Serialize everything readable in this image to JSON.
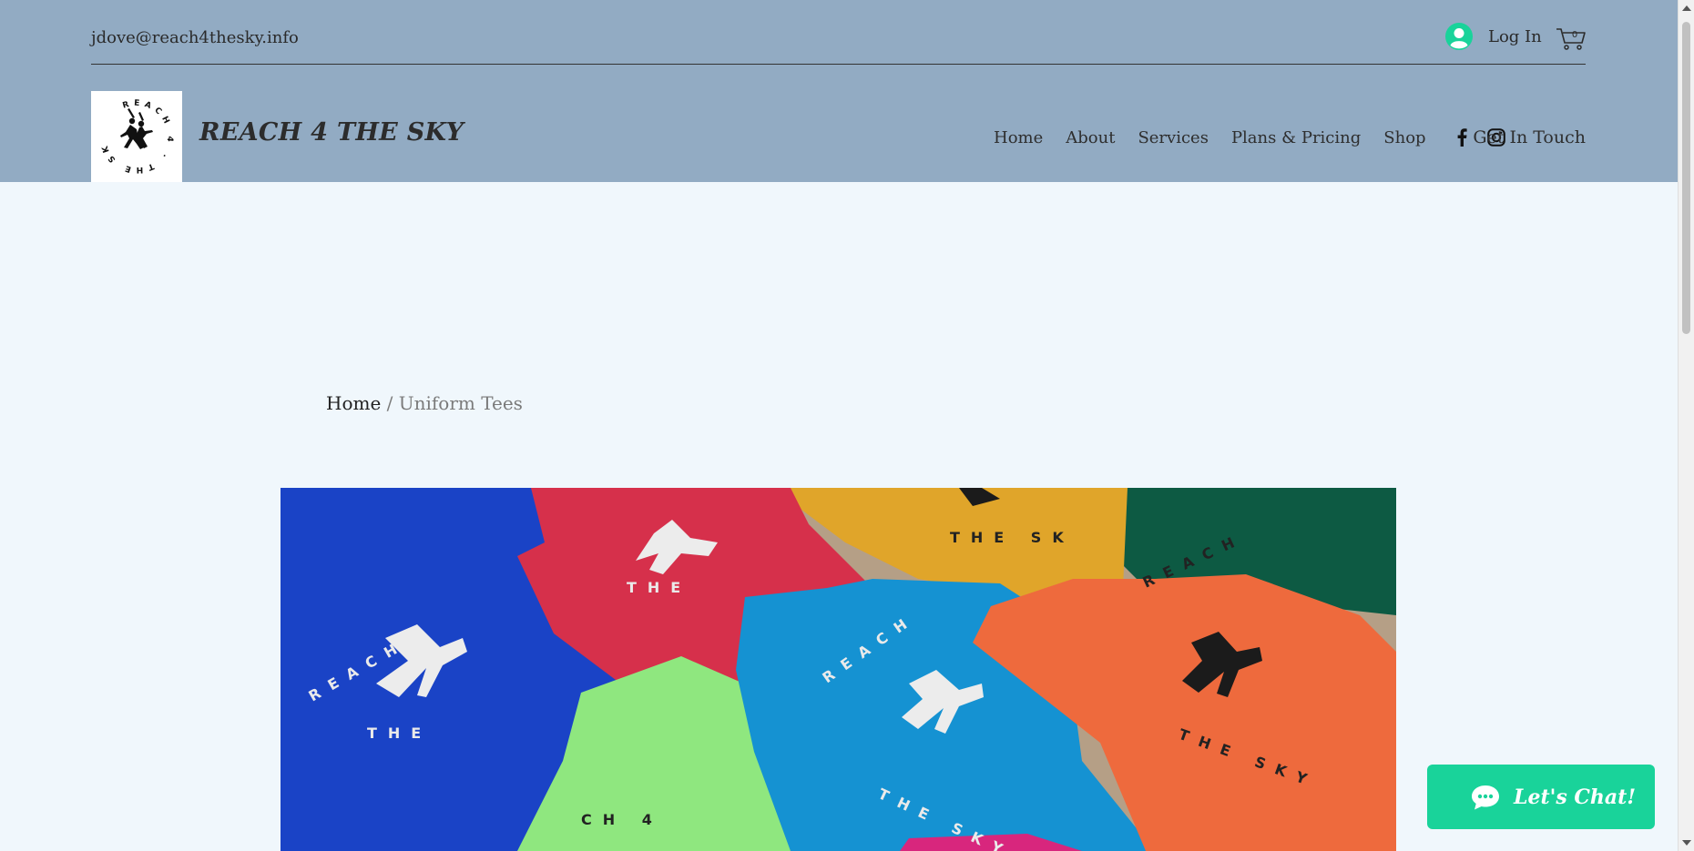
{
  "header": {
    "email": "jdove@reach4thesky.info",
    "login_label": "Log In",
    "cart_count": "0",
    "brand": "REACH 4 THE SKY",
    "logo_ring_text": "REACH 4 · THE SKY ·",
    "nav": [
      "Home",
      "About",
      "Services",
      "Plans & Pricing",
      "Shop"
    ],
    "social": [
      "facebook-icon",
      "instagram-icon"
    ],
    "cta": "Get In Touch"
  },
  "breadcrumb": {
    "home": "Home",
    "separator": " / ",
    "current": "Uniform Tees"
  },
  "product_image": {
    "description_icon": "tshirts-photo",
    "shirt_print": "REACH 4 · THE SKY ·"
  },
  "chat": {
    "label": "Let's Chat!"
  },
  "colors": {
    "header_bg": "#92ABC3",
    "page_bg": "#F0F7FC",
    "chat_bg": "#19D39A",
    "login_avatar": "#19D39A"
  }
}
